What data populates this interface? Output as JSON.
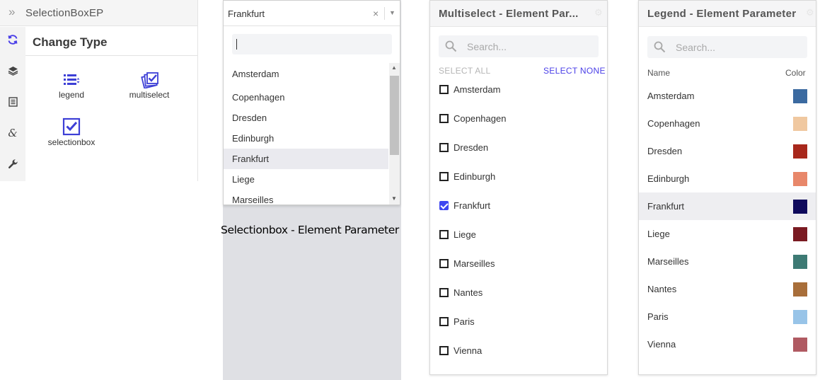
{
  "editor": {
    "breadcrumb_chevron": "»",
    "element_name": "SelectionBoxEP",
    "section_title": "Change Type",
    "rail_icons": [
      "refresh-icon",
      "layers-icon",
      "document-icon",
      "ampersand-icon",
      "wrench-icon"
    ],
    "types": [
      {
        "label": "legend",
        "icon": "legend-list-icon"
      },
      {
        "label": "multiselect",
        "icon": "multiselect-check-icon"
      },
      {
        "label": "selectionbox",
        "icon": "checkbox-checked-icon"
      }
    ]
  },
  "selectionbox": {
    "selected_value": "Frankfurt",
    "clear_glyph": "×",
    "arrow_glyph": "▼",
    "search_value": "",
    "options": [
      "Amsterdam",
      "Copenhagen",
      "Dresden",
      "Edinburgh",
      "Frankfurt",
      "Liege",
      "Marseilles"
    ],
    "selected_index": 4,
    "caption": "Selectionbox - Element Parameter"
  },
  "multiselect": {
    "title": "Multiselect - Element Par...",
    "search_placeholder": "Search...",
    "select_all": "SELECT ALL",
    "select_none": "SELECT NONE",
    "items": [
      {
        "label": "Amsterdam",
        "checked": false
      },
      {
        "label": "Copenhagen",
        "checked": false
      },
      {
        "label": "Dresden",
        "checked": false
      },
      {
        "label": "Edinburgh",
        "checked": false
      },
      {
        "label": "Frankfurt",
        "checked": true
      },
      {
        "label": "Liege",
        "checked": false
      },
      {
        "label": "Marseilles",
        "checked": false
      },
      {
        "label": "Nantes",
        "checked": false
      },
      {
        "label": "Paris",
        "checked": false
      },
      {
        "label": "Vienna",
        "checked": false
      }
    ]
  },
  "legend": {
    "title": "Legend - Element Parameter",
    "search_placeholder": "Search...",
    "col_name": "Name",
    "col_color": "Color",
    "selected_index": 4,
    "items": [
      {
        "label": "Amsterdam",
        "color": "#3b6aa0"
      },
      {
        "label": "Copenhagen",
        "color": "#f0c8a0"
      },
      {
        "label": "Dresden",
        "color": "#a8281c"
      },
      {
        "label": "Edinburgh",
        "color": "#e8876a"
      },
      {
        "label": "Frankfurt",
        "color": "#0f0a5c"
      },
      {
        "label": "Liege",
        "color": "#7a1a22"
      },
      {
        "label": "Marseilles",
        "color": "#3d7a74"
      },
      {
        "label": "Nantes",
        "color": "#a86e3a"
      },
      {
        "label": "Paris",
        "color": "#98c4e8"
      },
      {
        "label": "Vienna",
        "color": "#b05a62"
      }
    ]
  }
}
